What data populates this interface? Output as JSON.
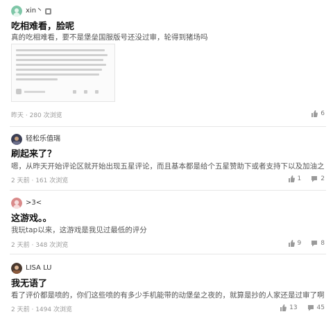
{
  "comments": [
    {
      "user": "xin丶",
      "has_badge": true,
      "title": "吃相难看，脸呢",
      "body": "真的吃相难看，要不是堡垒国服版号还没过审，轮得到猪场吗",
      "time": "昨天",
      "views": "280 次浏览",
      "likes": "6"
    },
    {
      "user": "轻松乐值瑞",
      "title": "刷起来了？",
      "body": "嗯，从昨天开始评论区就开始出现五星评论，而且基本都是给个五星赞助下或者支持下以及加油之...",
      "time": "2 天前",
      "views": "161 次浏览",
      "likes": "1",
      "comments": "2"
    },
    {
      "user": ">3<",
      "title": "这游戏。。",
      "body": "我玩tap以来，这游戏是我见过最低的评分",
      "time": "2 天前",
      "views": "348 次浏览",
      "likes": "9",
      "comments": "8"
    },
    {
      "user": "LISA LU",
      "title": "我无语了",
      "body": "看了评价都是喷的，你们这些喷的有多少手机能带的动堡垒之夜的，就算是抄的人家还是过审了啊...",
      "time": "2 天前",
      "views": "1494 次浏览",
      "likes": "13",
      "comments": "45"
    }
  ],
  "colors": {
    "divider": "#e6e6e6",
    "meta_text": "#999999",
    "title_text": "#111111"
  },
  "icons": {
    "like": "thumbs-up-icon",
    "comment": "comment-bubble-icon",
    "badge": "badge-icon"
  }
}
